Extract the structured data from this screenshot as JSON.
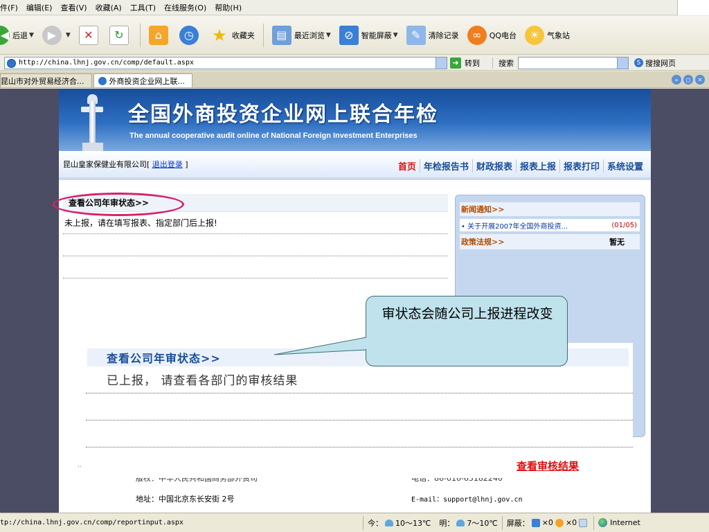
{
  "menu": [
    "件(F)",
    "编辑(E)",
    "查看(V)",
    "收藏(A)",
    "工具(T)",
    "在线服务(O)",
    "帮助(H)"
  ],
  "toolbar": {
    "back": "后退",
    "favorites": "收藏夹",
    "recent": "最近浏览",
    "smart_block": "智能屏蔽",
    "clear_history": "清除记录",
    "qq_radio": "QQ电台",
    "weather": "气象站"
  },
  "address": {
    "url": "http://china.lhnj.gov.cn/comp/default.aspx",
    "go": "转到",
    "search_label": "搜索",
    "search_value": "",
    "sogou": "搜搜网页"
  },
  "tabs": [
    {
      "label": "昆山市对外贸易经济合..."
    },
    {
      "label": "外商投资企业网上联..."
    }
  ],
  "banner": {
    "title_cn": "全国外商投资企业网上联合年检",
    "title_en": "The annual cooperative audit online  of National Foreign Investment Enterprises"
  },
  "nav": {
    "company": "昆山皇家保健业有限公司[",
    "logout": "退出登录",
    "company_end": "]",
    "links": [
      "首页",
      "年检报告书",
      "财政报表",
      "报表上报",
      "报表打印",
      "系统设置"
    ]
  },
  "status": {
    "heading": "查看公司年审状态>>",
    "text": "未上报，请在填写报表、指定部门后上报!"
  },
  "sidebar": {
    "news_heading": "新闻通知>>",
    "news_item": "• 关于开展2007年全国外商投资...",
    "news_date": "(01/05)",
    "policy_heading": "政策法规>>",
    "policy_value": "暂无"
  },
  "callout": {
    "text": "审状态会随公司上报进程改变"
  },
  "zoom": {
    "heading": "查看公司年审状态>>",
    "text": "已上报， 请查看各部门的审核结果"
  },
  "review_link": "查看审核结果",
  "footer": {
    "sponsor_partial": "版权：中华人民共和国商务部外资司",
    "phone_partial": "电话：86-010-65182240",
    "address": "地址：中国北京东长安街 2号",
    "email": "E-mail：support@lhnj.gov.cn"
  },
  "statusbar": {
    "url": "tp://china.lhnj.gov.cn/comp/reportinput.aspx",
    "today": "今：",
    "today_temp": "10～13℃",
    "tomorrow": "明：",
    "tomorrow_temp": "7～10℃",
    "block_label": "屏蔽：",
    "block_count_1": "×0",
    "block_count_2": "×0",
    "zone": "Internet"
  },
  "colors": {
    "accent_red": "#e01010",
    "nav_blue": "#1a4d99",
    "highlight_pink": "#d6206e",
    "callout_fill": "#bfe2ec"
  }
}
